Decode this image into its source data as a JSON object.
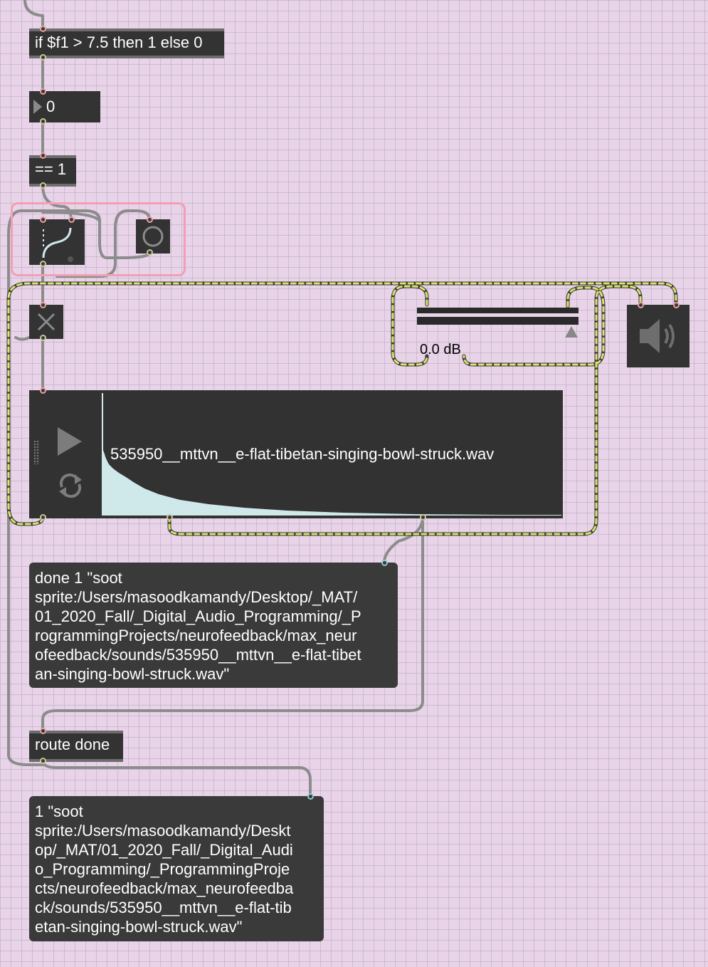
{
  "objects": {
    "expr_box": "if $f1 > 7.5 then 1 else 0",
    "number_box": "0",
    "compare_box": "== 1",
    "route_box": "route done"
  },
  "gain": {
    "label": "0.0 dB",
    "value_db": 0.0
  },
  "playlist": {
    "filename": "535950__mttvn__e-flat-tibetan-singing-bowl-struck.wav"
  },
  "messages": {
    "done_message": "done 1 \"soot\nsprite:/Users/masoodkamandy/Desktop/_MAT/\n01_2020_Fall/_Digital_Audio_Programming/_P\nrogrammingProjects/neurofeedback/max_neur\nofeedback/sounds/535950__mttvn__e-flat-tibet\nan-singing-bowl-struck.wav\"",
    "result_message": "1 \"soot\nsprite:/Users/masoodkamandy/Deskt\nop/_MAT/01_2020_Fall/_Digital_Audi\no_Programming/_ProgrammingProje\ncts/neurofeedback/max_neurofeedba\nck/sounds/535950__mttvn__e-flat-tib\netan-singing-bowl-struck.wav\""
  },
  "colors": {
    "canvas": "#e8d3e8",
    "object": "#333333",
    "selection": "#f0a0b4",
    "audio_patchcord": "#d7e36a"
  },
  "icons": [
    "triangle-right-icon",
    "toggle-circle-icon",
    "close-x-icon",
    "play-icon",
    "loop-icon",
    "speaker-icon",
    "gate-icon"
  ]
}
